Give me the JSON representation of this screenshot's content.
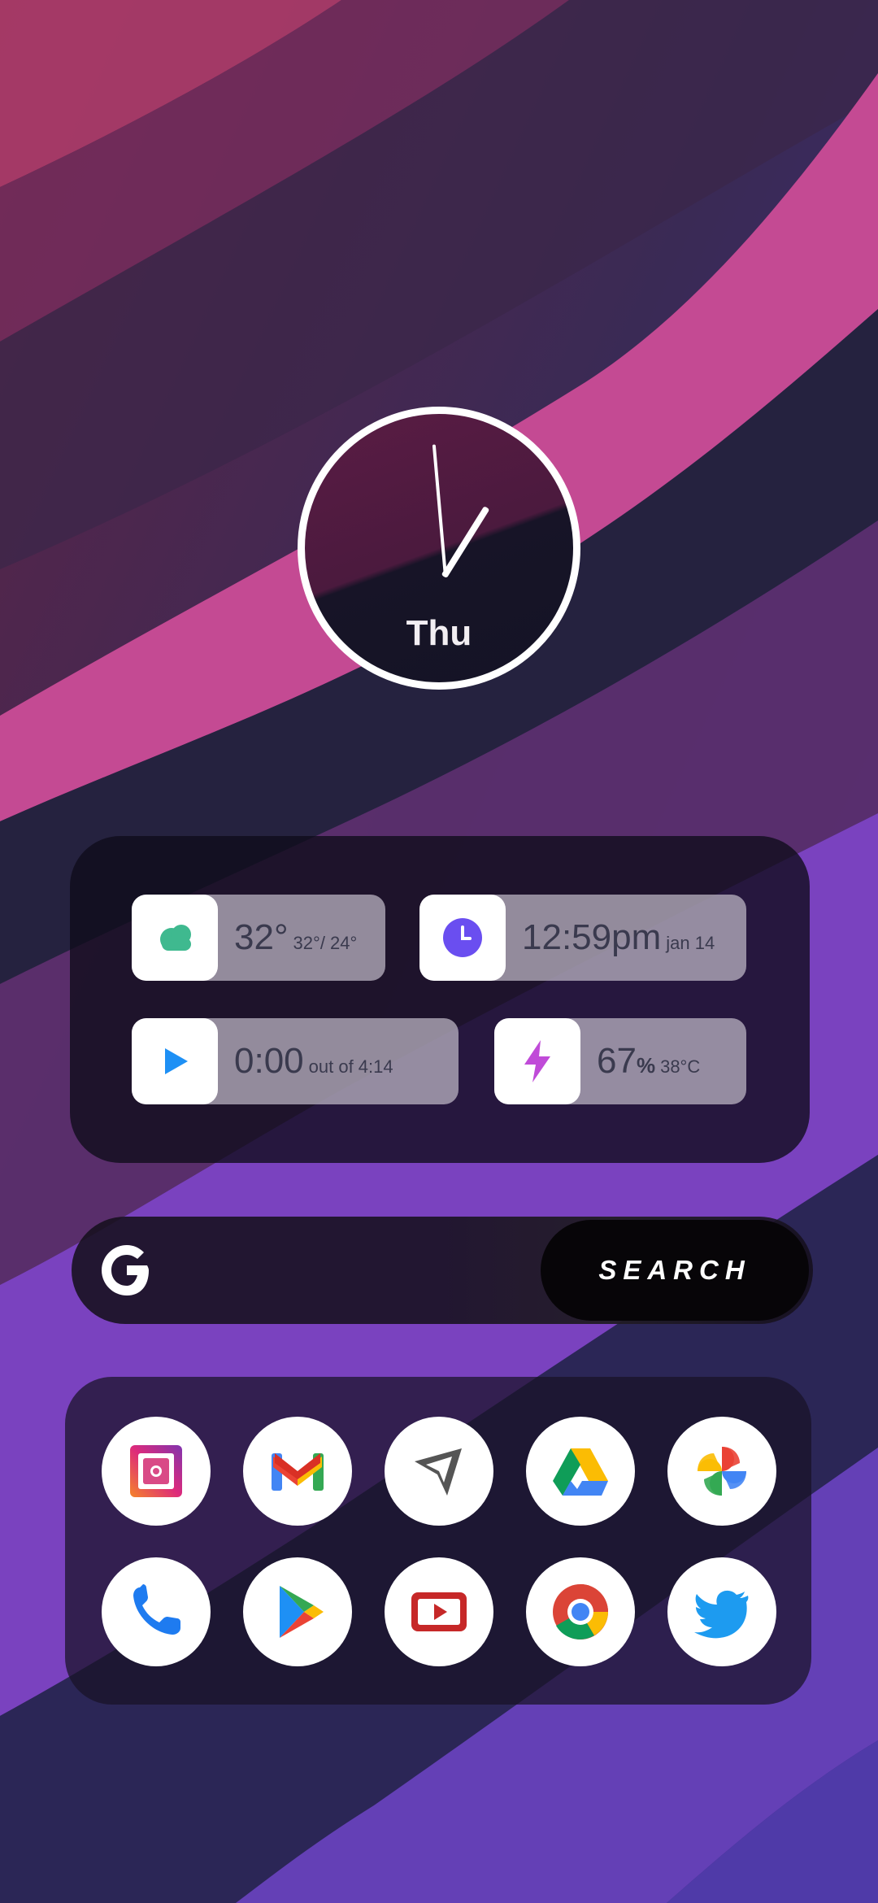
{
  "clock": {
    "day": "Thu"
  },
  "widgets": {
    "weather": {
      "temp": "32°",
      "range": "32°/ 24°"
    },
    "time": {
      "time": "12:59pm",
      "date": "jan 14"
    },
    "media": {
      "position": "0:00",
      "duration": "out of 4:14"
    },
    "battery": {
      "percent": "67",
      "unit": "%",
      "temp": "38°C"
    }
  },
  "search": {
    "label": "SEARCH",
    "logo": "G"
  },
  "apps": {
    "row1": [
      "Instagram",
      "Gmail",
      "Direct",
      "Drive",
      "Photos"
    ],
    "row2": [
      "Phone",
      "Play Store",
      "YouTube",
      "Chrome",
      "Twitter"
    ]
  },
  "colors": {
    "weather_icon": "#3fb98f",
    "clock_icon": "#6a4ef0",
    "play_icon": "#1e90f5",
    "bolt_icon": "#c04bd8"
  }
}
